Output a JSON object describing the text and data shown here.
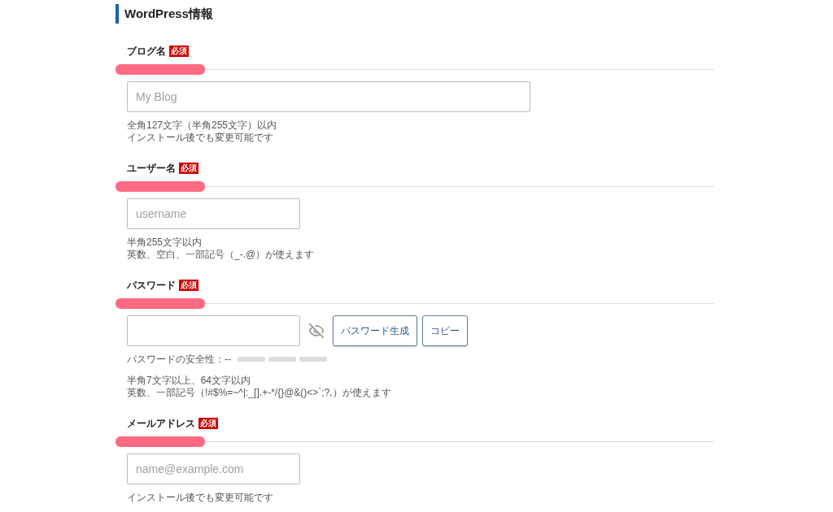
{
  "heading": "WordPress情報",
  "fields": [
    {
      "kind": "wide-text",
      "label": "ブログ名",
      "badge": "必須",
      "placeholder": "My Blog",
      "notes": [
        "全角127文字（半角255文字）以内",
        "インストール後でも変更可能です"
      ]
    },
    {
      "kind": "text",
      "label": "ユーザー名",
      "badge": "必須",
      "placeholder": "username",
      "notes": [
        "半角255文字以内",
        "英数、空白、一部記号（_-.@）が使えます"
      ]
    },
    {
      "kind": "password",
      "label": "パスワード",
      "badge": "必須",
      "buttons": [
        "パスワード生成",
        "コピー"
      ],
      "strength": {
        "label": "パスワードの安全性：--"
      },
      "notes": [
        "半角7文字以上、64文字以内",
        "英数、一部記号（!#$%=~^|:_[].+-*/{}@&()<>`;?,）が使えます"
      ]
    },
    {
      "kind": "text",
      "label": "メールアドレス",
      "badge": "必須",
      "placeholder": "name@example.com",
      "notes": [
        "インストール後でも変更可能です"
      ]
    }
  ]
}
